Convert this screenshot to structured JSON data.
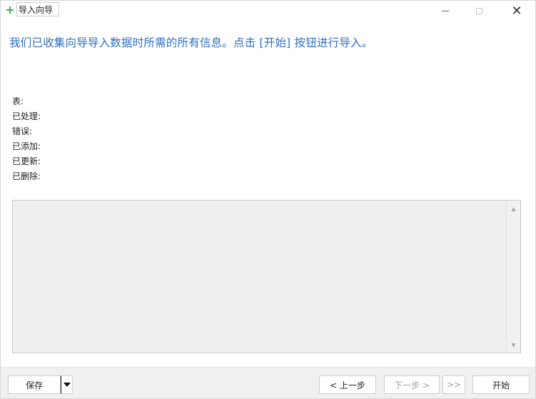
{
  "window": {
    "title": "导入向导",
    "close_glyph": "✕",
    "maximize_icon": "maximize-icon",
    "minimize_icon": "minimize-icon"
  },
  "headline": "我们已收集向导导入数据时所需的所有信息。点击 [开始] 按钮进行导入。",
  "stats": [
    {
      "label": "表:",
      "value": ""
    },
    {
      "label": "已处理:",
      "value": ""
    },
    {
      "label": "错误:",
      "value": ""
    },
    {
      "label": "已添加:",
      "value": ""
    },
    {
      "label": "已更新:",
      "value": ""
    },
    {
      "label": "已删除:",
      "value": ""
    }
  ],
  "log": {
    "content": ""
  },
  "buttons": {
    "save": "保存",
    "prev": "< 上一步",
    "next": "下一步 >",
    "skip": ">>",
    "start": "开始"
  },
  "colors": {
    "headline": "#2e6fc2",
    "icon_green": "#4caf50"
  }
}
